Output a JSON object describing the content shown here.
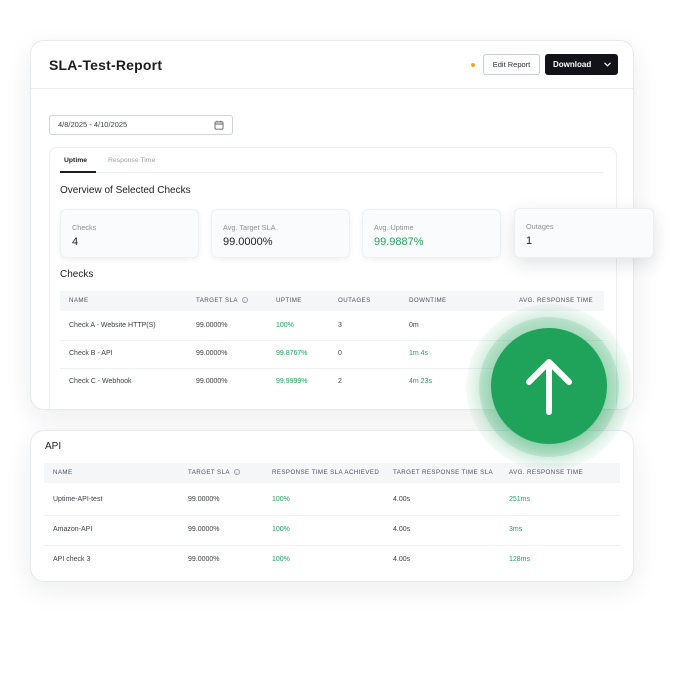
{
  "report": {
    "title": "SLA-Test-Report",
    "edit_label": "Edit Report",
    "download_label": "Download",
    "date_range": "4/8/2025 - 4/10/2025",
    "tabs": [
      "Uptime",
      "Response Time"
    ],
    "overview_title": "Overview of Selected Checks",
    "stats": [
      {
        "label": "Checks",
        "value": "4"
      },
      {
        "label": "Avg. Target SLA",
        "value": "99.0000%"
      },
      {
        "label": "Avg. Uptime",
        "value": "99.9887%"
      },
      {
        "label": "Outages",
        "value": "1"
      }
    ],
    "checks_title": "Checks",
    "checks_columns": [
      "NAME",
      "TARGET SLA",
      "UPTIME",
      "OUTAGES",
      "DOWNTIME",
      "AVG. RESPONSE TIME"
    ],
    "checks_rows": [
      {
        "name": "Check A - Website HTTP(S)",
        "target": "99.0000%",
        "uptime": "100%",
        "outages": "3",
        "downtime": "0m"
      },
      {
        "name": "Check B - API",
        "target": "99.0000%",
        "uptime": "99.8767%",
        "outages": "0",
        "downtime": "1m 4s"
      },
      {
        "name": "Check C - Webhook",
        "target": "99.0000%",
        "uptime": "99.9999%",
        "outages": "2",
        "downtime": "4m 23s"
      }
    ]
  },
  "api": {
    "title": "API",
    "columns": [
      "NAME",
      "TARGET SLA",
      "RESPONSE TIME SLA ACHIEVED",
      "TARGET RESPONSE TIME SLA",
      "AVG. RESPONSE TIME"
    ],
    "rows": [
      {
        "name": "Uptime-API-test",
        "target": "99.0000%",
        "achieved": "100%",
        "target_rt": "4.00s",
        "avg_rt": "251ms"
      },
      {
        "name": "Amazon-API",
        "target": "99.0000%",
        "achieved": "100%",
        "target_rt": "4.00s",
        "avg_rt": "3ms"
      },
      {
        "name": "API check 3",
        "target": "99.0000%",
        "achieved": "100%",
        "target_rt": "4.00s",
        "avg_rt": "128ms"
      }
    ]
  },
  "colors": {
    "accent_green": "#1fa35a",
    "dark_button": "#111318",
    "status_dot": "#f5a524"
  },
  "icons": [
    "calendar-icon",
    "chevron-down-icon",
    "info-icon",
    "arrow-up-icon"
  ]
}
